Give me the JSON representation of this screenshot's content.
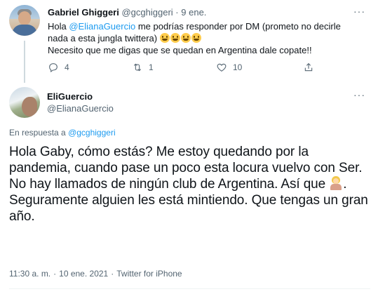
{
  "parent_tweet": {
    "author_name": "Gabriel Ghiggeri",
    "author_handle": "@gcghiggeri",
    "separator": "·",
    "date": "9 ene.",
    "more_label": "···",
    "text_line1_prefix": "Hola ",
    "mention": "@ElianaGuercio",
    "text_line1_suffix": " me podrías responder por DM (prometo no decirle nada a esta jungla twittera)",
    "text_line2": "Necesito que me digas que se quedan en Argentina dale copate!!",
    "emojis": [
      "grinning-face-icon",
      "grinning-squinting-face-icon",
      "smiling-face-icon",
      "winking-face-icon"
    ],
    "stats": {
      "replies": "4",
      "retweets": "1",
      "likes": "10"
    }
  },
  "main_tweet": {
    "author_name": "EliGuercio",
    "author_handle": "@ElianaGuercio",
    "more_label": "···",
    "reply_prefix": "En respuesta a ",
    "reply_mention": "@gcghiggeri",
    "text_part1": "Hola Gaby, cómo estás? Me estoy quedando por la pandemia, cuando pase un poco esta locura vuelvo con Ser.",
    "text_part2": "No hay llamados de ningún club de Argentina. Así que ",
    "text_part3": ". Seguramente alguien les está mintiendo. Que tengas un gran año.",
    "emoji": "person-shrugging-icon",
    "time": "11:30 a. m.",
    "date": "10 ene. 2021",
    "separator": "·",
    "source": "Twitter for iPhone"
  },
  "colors": {
    "link": "#1d9bf0",
    "secondary_text": "#536471",
    "text": "#0f1419"
  }
}
